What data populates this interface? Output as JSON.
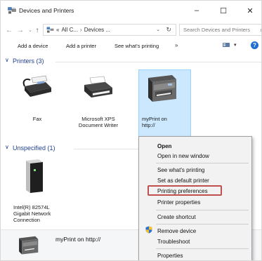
{
  "window": {
    "title": "Devices and Printers",
    "minimize": "–",
    "maximize": "☐",
    "close": "✕"
  },
  "address": {
    "back": "←",
    "forward": "→",
    "recent": "⌄",
    "up": "↑",
    "crumb_prefix": "«",
    "crumb_1": "All C...",
    "crumb_sep": "›",
    "crumb_2": "Devices ...",
    "dropdown": "⌄",
    "refresh": "↻",
    "search_placeholder": "Search Devices and Printers",
    "search_icon": "⌕"
  },
  "commands": {
    "add_device": "Add a device",
    "add_printer": "Add a printer",
    "see_printing": "See what's printing",
    "more": "»",
    "view_dd": "▾",
    "help": "?"
  },
  "groups": {
    "printers": {
      "chevron": "∨",
      "title": "Printers (3)"
    },
    "unspecified": {
      "chevron": "∨",
      "title": "Unspecified (1)"
    }
  },
  "devices": {
    "fax": "Fax",
    "xps": "Microsoft XPS\nDocument Writer",
    "myprint": "myPrint on\nhttp://",
    "nic": "Intel(R) 82574L\nGigabit Network\nConnection"
  },
  "context_menu": {
    "items": [
      "Open",
      "Open in new window",
      "See what's printing",
      "Set as default printer",
      "Printing preferences",
      "Printer properties",
      "Create shortcut",
      "Remove device",
      "Troubleshoot",
      "Properties"
    ],
    "highlight_color": "#c0504d"
  },
  "details": {
    "name": "myPrint on http://"
  },
  "colors": {
    "group_title": "#1e3f8f",
    "selection_fill": "#cce8ff",
    "selection_border": "#99d1ff",
    "help_badge": "#1f6fd0"
  }
}
